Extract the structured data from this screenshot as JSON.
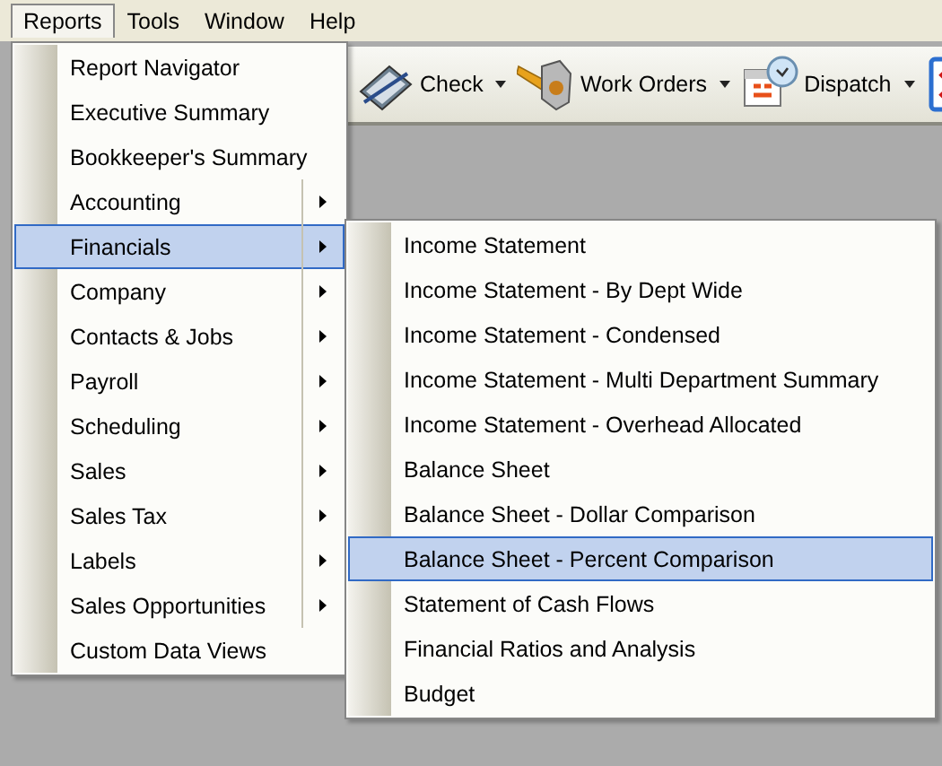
{
  "menubar": [
    {
      "label": "Reports",
      "selected": true
    },
    {
      "label": "Tools",
      "selected": false
    },
    {
      "label": "Window",
      "selected": false
    },
    {
      "label": "Help",
      "selected": false
    }
  ],
  "toolbar": [
    {
      "label": "Check",
      "kind": "check"
    },
    {
      "label": "Work Orders",
      "kind": "work-orders"
    },
    {
      "label": "Dispatch",
      "kind": "dispatch"
    },
    {
      "kind": "checklist"
    }
  ],
  "reports_menu": [
    {
      "label": "Report Navigator",
      "has_submenu": false,
      "selected": false
    },
    {
      "label": "Executive Summary",
      "has_submenu": false,
      "selected": false
    },
    {
      "label": "Bookkeeper's Summary",
      "has_submenu": false,
      "selected": false
    },
    {
      "label": "Accounting",
      "has_submenu": true,
      "selected": false
    },
    {
      "label": "Financials",
      "has_submenu": true,
      "selected": true
    },
    {
      "label": "Company",
      "has_submenu": true,
      "selected": false
    },
    {
      "label": "Contacts & Jobs",
      "has_submenu": true,
      "selected": false
    },
    {
      "label": "Payroll",
      "has_submenu": true,
      "selected": false
    },
    {
      "label": "Scheduling",
      "has_submenu": true,
      "selected": false
    },
    {
      "label": "Sales",
      "has_submenu": true,
      "selected": false
    },
    {
      "label": "Sales Tax",
      "has_submenu": true,
      "selected": false
    },
    {
      "label": "Labels",
      "has_submenu": true,
      "selected": false
    },
    {
      "label": "Sales Opportunities",
      "has_submenu": true,
      "selected": false
    },
    {
      "label": "Custom Data Views",
      "has_submenu": false,
      "selected": false
    }
  ],
  "financials_submenu": [
    {
      "label": "Income Statement",
      "selected": false
    },
    {
      "label": "Income Statement - By Dept Wide",
      "selected": false
    },
    {
      "label": "Income Statement - Condensed",
      "selected": false
    },
    {
      "label": "Income Statement - Multi Department Summary",
      "selected": false
    },
    {
      "label": "Income Statement - Overhead Allocated",
      "selected": false
    },
    {
      "label": "Balance Sheet",
      "selected": false
    },
    {
      "label": "Balance Sheet - Dollar Comparison",
      "selected": false
    },
    {
      "label": "Balance Sheet - Percent Comparison",
      "selected": true
    },
    {
      "label": "Statement of Cash Flows",
      "selected": false
    },
    {
      "label": "Financial Ratios and Analysis",
      "selected": false
    },
    {
      "label": "Budget",
      "selected": false
    }
  ]
}
